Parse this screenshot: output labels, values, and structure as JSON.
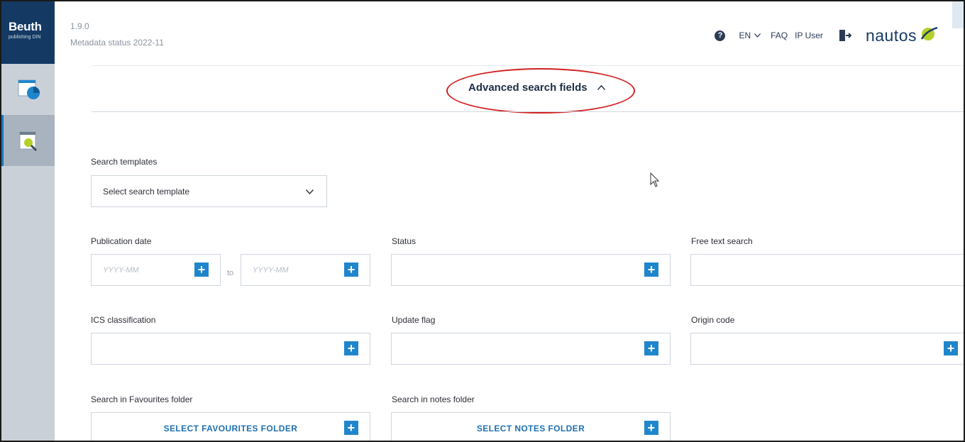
{
  "brand": {
    "name": "Beuth",
    "subtitle": "publishing DIN"
  },
  "header": {
    "version": "1.9.0",
    "metadata_status": "Metadata status 2022-11",
    "help_icon": "?",
    "language": "EN",
    "faq": "FAQ",
    "user": "IP User",
    "logo_text": "nautos"
  },
  "sidebar": {
    "items": [
      {
        "icon": "dashboard-icon"
      },
      {
        "icon": "folder-search-icon"
      }
    ]
  },
  "advanced": {
    "label": "Advanced search fields",
    "caret": "^"
  },
  "form": {
    "templates": {
      "label": "Search templates",
      "value": "Select search template"
    },
    "publication_date": {
      "label": "Publication date",
      "from_placeholder": "YYYY-MM",
      "to_label": "to",
      "to_placeholder": "YYYY-MM"
    },
    "status": {
      "label": "Status",
      "value": ""
    },
    "free_text": {
      "label": "Free text search",
      "value": ""
    },
    "ics": {
      "label": "ICS classification",
      "value": ""
    },
    "update_flag": {
      "label": "Update flag",
      "value": ""
    },
    "origin_code": {
      "label": "Origin code",
      "value": ""
    },
    "favourites": {
      "label": "Search in Favourites folder",
      "button": "SELECT FAVOURITES FOLDER"
    },
    "notes": {
      "label": "Search in notes folder",
      "button": "SELECT NOTES FOLDER"
    }
  },
  "colors": {
    "brand_navy": "#143a64",
    "accent_blue": "#1f86cc",
    "highlight_red": "#d32020"
  }
}
